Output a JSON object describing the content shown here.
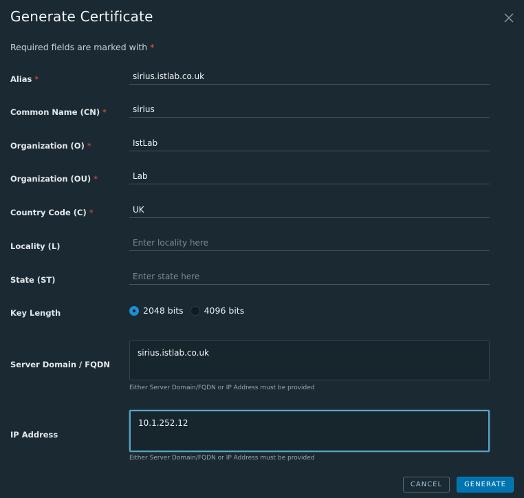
{
  "dialog": {
    "title": "Generate Certificate",
    "required_note": "Required fields are marked with",
    "required_marker": "*"
  },
  "fields": {
    "alias": {
      "label": "Alias",
      "value": "sirius.istlab.co.uk",
      "required": true
    },
    "common_name": {
      "label": "Common Name (CN)",
      "value": "sirius",
      "required": true
    },
    "organization": {
      "label": "Organization (O)",
      "value": "IstLab",
      "required": true
    },
    "organization_unit": {
      "label": "Organization (OU)",
      "value": "Lab",
      "required": true
    },
    "country_code": {
      "label": "Country Code (C)",
      "value": "UK",
      "required": true
    },
    "locality": {
      "label": "Locality (L)",
      "value": "",
      "placeholder": "Enter locality here",
      "required": false
    },
    "state": {
      "label": "State (ST)",
      "value": "",
      "placeholder": "Enter state here",
      "required": false
    },
    "key_length": {
      "label": "Key Length",
      "options": [
        {
          "label": "2048 bits",
          "selected": true
        },
        {
          "label": "4096 bits",
          "selected": false
        }
      ]
    },
    "server_domain": {
      "label": "Server Domain / FQDN",
      "value": "sirius.istlab.co.uk",
      "helper": "Either Server Domain/FQDN or IP Address must be provided"
    },
    "ip_address": {
      "label": "IP Address",
      "value": "10.1.252.12",
      "helper": "Either Server Domain/FQDN or IP Address must be provided"
    }
  },
  "buttons": {
    "cancel": "CANCEL",
    "generate": "GENERATE"
  },
  "colors": {
    "background": "#1b2a32",
    "required_star": "#f54f47",
    "primary": "#0074b0",
    "focus_border": "#5aa6c8"
  }
}
